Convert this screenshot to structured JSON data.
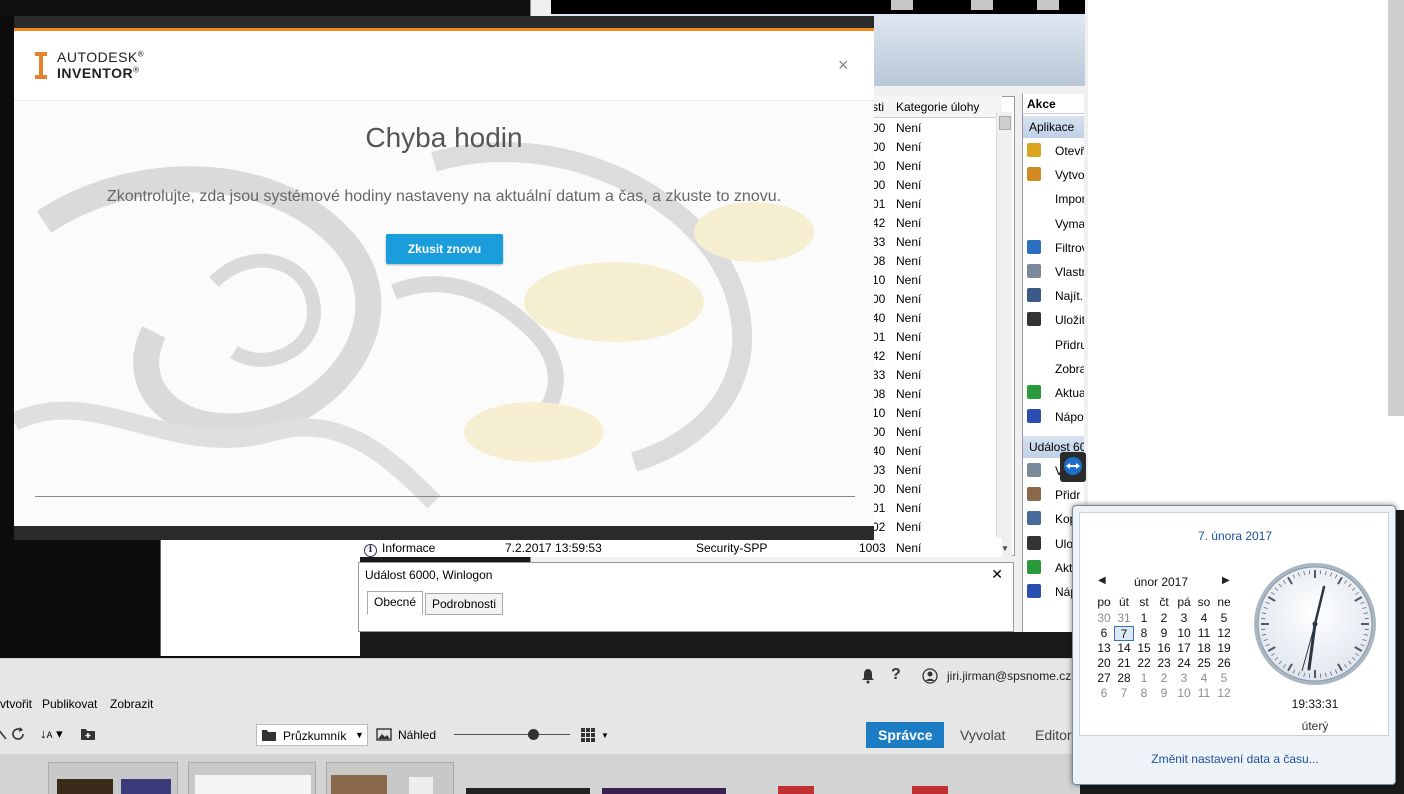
{
  "dialog": {
    "brand_line1": "AUTODESK",
    "brand_line1_mark": "®",
    "brand_line2": "INVENTOR",
    "brand_line2_mark": "®",
    "close_glyph": "×",
    "title": "Chyba hodin",
    "message": "Zkontrolujte, zda jsou systémové hodiny nastaveny na aktuální datum a čas, a zkuste to znovu.",
    "retry_label": "Zkusit znovu",
    "accent_color": "#ef8a1d",
    "button_color": "#1a9ddb"
  },
  "event_viewer": {
    "columns": [
      "sti",
      "Kategorie úlohy"
    ],
    "rows": [
      {
        "c1": "00",
        "c2": "Není"
      },
      {
        "c1": "00",
        "c2": "Není"
      },
      {
        "c1": "00",
        "c2": "Není"
      },
      {
        "c1": "00",
        "c2": "Není"
      },
      {
        "c1": "01",
        "c2": "Není"
      },
      {
        "c1": "42",
        "c2": "Není"
      },
      {
        "c1": "33",
        "c2": "Není"
      },
      {
        "c1": "08",
        "c2": "Není"
      },
      {
        "c1": "10",
        "c2": "Není"
      },
      {
        "c1": "00",
        "c2": "Není"
      },
      {
        "c1": "40",
        "c2": "Není"
      },
      {
        "c1": "01",
        "c2": "Není"
      },
      {
        "c1": "42",
        "c2": "Není"
      },
      {
        "c1": "33",
        "c2": "Není"
      },
      {
        "c1": "08",
        "c2": "Není"
      },
      {
        "c1": "10",
        "c2": "Není"
      },
      {
        "c1": "00",
        "c2": "Není"
      },
      {
        "c1": "40",
        "c2": "Není"
      },
      {
        "c1": "03",
        "c2": "Není"
      },
      {
        "c1": "00",
        "c2": "Není"
      },
      {
        "c1": "01",
        "c2": "Není"
      },
      {
        "c1": "02",
        "c2": "Není"
      }
    ],
    "last_row": {
      "level": "Informace",
      "date": "7.2.2017 13:59:53",
      "source": "Security-SPP",
      "id": "1003",
      "category": "Není"
    },
    "detail_title": "Událost 6000, Winlogon",
    "detail_close": "✕",
    "tabs": [
      "Obecné",
      "Podrobnosti"
    ],
    "actions_title": "Akce",
    "actions_section1": "Aplikace",
    "actions_section2": "Událost 60",
    "actions1": [
      "Otevř",
      "Vytvo",
      "Impor",
      "Vyma",
      "Filtrov",
      "Vlastn",
      "Najít...",
      "Uložit",
      "Přidru",
      "Zobra",
      "Aktua",
      "Nápov"
    ],
    "actions2": [
      "V",
      "Přidr",
      "Kop",
      "Ulo",
      "Akt",
      "Náp"
    ]
  },
  "photo_app": {
    "account": "jiri.jirman@spsnome.cz",
    "help_glyph": "?",
    "menu": [
      "vtvořit",
      "Publikovat",
      "Zobrazit"
    ],
    "view_dropdown": "Průzkumník",
    "preview_label": "Náhled",
    "modes": [
      "Správce",
      "Vyvolat",
      "Editor"
    ]
  },
  "calendar": {
    "date_link": "7. února 2017",
    "month_label": "únor 2017",
    "weekdays": [
      "po",
      "út",
      "st",
      "čt",
      "pá",
      "so",
      "ne"
    ],
    "weeks": [
      [
        "30",
        "31",
        "1",
        "2",
        "3",
        "4",
        "5"
      ],
      [
        "6",
        "7",
        "8",
        "9",
        "10",
        "11",
        "12"
      ],
      [
        "13",
        "14",
        "15",
        "16",
        "17",
        "18",
        "19"
      ],
      [
        "20",
        "21",
        "22",
        "23",
        "24",
        "25",
        "26"
      ],
      [
        "27",
        "28",
        "1",
        "2",
        "3",
        "4",
        "5"
      ],
      [
        "6",
        "7",
        "8",
        "9",
        "10",
        "11",
        "12"
      ]
    ],
    "time": "19:33:31",
    "day_name": "úterý",
    "change_link": "Změnit nastavení data a času..."
  }
}
